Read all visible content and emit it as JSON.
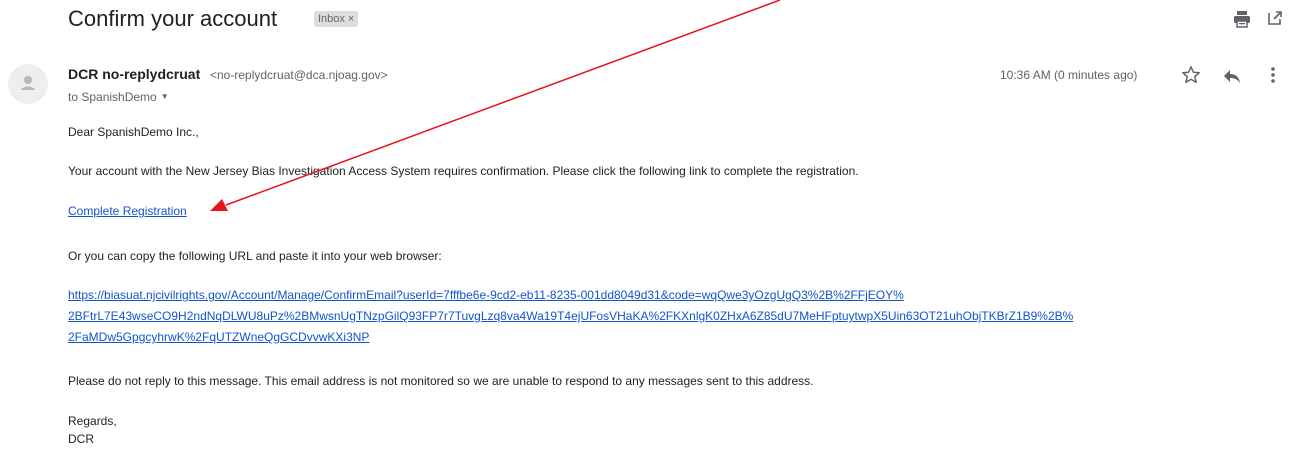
{
  "email": {
    "subject": "Confirm your account",
    "label_chip": "Inbox",
    "label_chip_close": "×",
    "sender": {
      "name": "DCR no-replydcruat",
      "email": "<no-replydcruat@dca.njoag.gov>"
    },
    "recipient": "to SpanishDemo",
    "timestamp": "10:36 AM (0 minutes ago)",
    "body": {
      "greeting": "Dear SpanishDemo Inc.,",
      "paragraph1": "Your account with the New Jersey Bias Investigation Access System requires confirmation. Please click the following link to complete the registration.",
      "complete_link": "Complete Registration",
      "paragraph2": "Or you can copy the following URL and paste it into your web browser:",
      "url_lines": [
        "https://biasuat.njcivilrights.gov/Account/Manage/ConfirmEmail?userId=7fffbe6e-9cd2-eb11-8235-001dd8049d31&code=wqQwe3yOzgUgQ3%2B%2FFjEOY%",
        "2BFtrL7E43wseCO9H2ndNqDLWU8uPz%2BMwsnUgTNzpGilQ93FP7r7TuvgLzq8va4Wa19T4ejUFosVHaKA%2FKXnlgK0ZHxA6Z85dU7MeHFptuytwpX5Uin63OT21uhObjTKBrZ1B9%2B%",
        "2FaMDw5GpgcyhrwK%2FqUTZWneQgGCDvvwKXi3NP"
      ],
      "paragraph3": "Please do not reply to this message. This email address is not monitored so we are unable to respond to any messages sent to this address.",
      "regards": "Regards,",
      "signature": "DCR"
    }
  },
  "icons": {
    "print": "print-icon",
    "popout": "open-in-new-window-icon",
    "avatar": "person-avatar-icon",
    "star": "star-icon",
    "reply": "reply-icon",
    "more": "more-vertical-icon",
    "recipient_details": "chevron-down-icon"
  },
  "colors": {
    "link": "#1155cc",
    "annotation_arrow": "#e8141b",
    "chip_background": "#dddddd"
  }
}
